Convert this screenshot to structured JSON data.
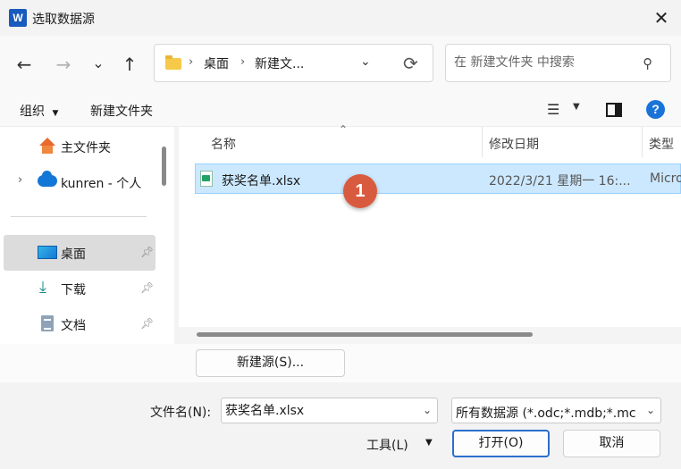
{
  "window": {
    "title": "选取数据源",
    "app_icon": "W"
  },
  "nav": {
    "back": "←",
    "forward": "→",
    "recent": "⌄",
    "up": "↑",
    "breadcrumb": [
      "桌面",
      "新建文..."
    ],
    "search_placeholder": "在 新建文件夹 中搜索"
  },
  "toolbar": {
    "organize": "组织",
    "new_folder": "新建文件夹",
    "help": "?"
  },
  "sidebar": {
    "items": [
      {
        "label": "主文件夹",
        "icon": "home-icon"
      },
      {
        "label": "kunren - 个人",
        "icon": "onedrive-cloud-icon"
      },
      {
        "label": "桌面",
        "icon": "desktop-icon",
        "pinned": true,
        "selected": true
      },
      {
        "label": "下载",
        "icon": "download-icon",
        "pinned": true
      },
      {
        "label": "文档",
        "icon": "documents-icon",
        "pinned": true
      }
    ]
  },
  "files": {
    "columns": [
      "名称",
      "修改日期",
      "类型"
    ],
    "rows": [
      {
        "name": "获奖名单.xlsx",
        "modified": "2022/3/21 星期一 16:...",
        "type": "Micro",
        "selected": true
      }
    ],
    "annotation": "1"
  },
  "buttons": {
    "new_source": "新建源(S)...",
    "tools": "工具(L)",
    "open": "打开(O)",
    "cancel": "取消"
  },
  "filename": {
    "label": "文件名(N):",
    "value": "获奖名单.xlsx"
  },
  "filetype": {
    "value": "所有数据源 (*.odc;*.mdb;*.mc"
  },
  "colors": {
    "selection_bg": "#cce8ff",
    "selection_border": "#99d1ff",
    "accent": "#2a6fce",
    "badge": "#d95b3f"
  }
}
